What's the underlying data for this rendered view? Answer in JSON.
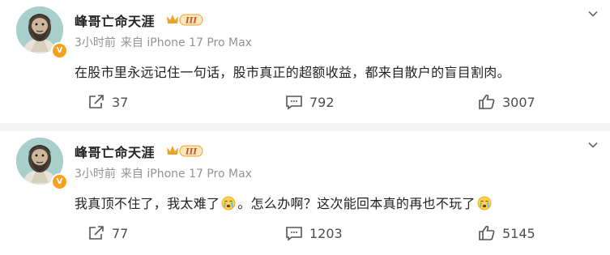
{
  "posts": [
    {
      "username": "峰哥亡命天涯",
      "vip_level": "III",
      "verify_mark": "V",
      "time": "3小时前",
      "source": "来自 iPhone 17 Pro Max",
      "content": "在股市里永远记住一句话，股市真正的超额收益，都来自散户的盲目割肉。",
      "reposts": "37",
      "comments": "792",
      "likes": "3007"
    },
    {
      "username": "峰哥亡命天涯",
      "vip_level": "III",
      "verify_mark": "V",
      "time": "3小时前",
      "source": "来自 iPhone 17 Pro Max",
      "content_segments": [
        "我真顶不住了，我太难了",
        "。怎么办啊？这次能回本真的再也不玩了"
      ],
      "reposts": "77",
      "comments": "1203",
      "likes": "5145"
    }
  ],
  "colors": {
    "text": "#222222",
    "meta": "#939393",
    "action": "#4d4d4d",
    "separator": "#f3f3f3",
    "verify_badge": "#f7a01c",
    "vip_gold": "#e9a52b"
  },
  "icons": [
    "chevron-down-icon",
    "repost-icon",
    "comment-icon",
    "like-icon",
    "crying-emoji-icon"
  ]
}
